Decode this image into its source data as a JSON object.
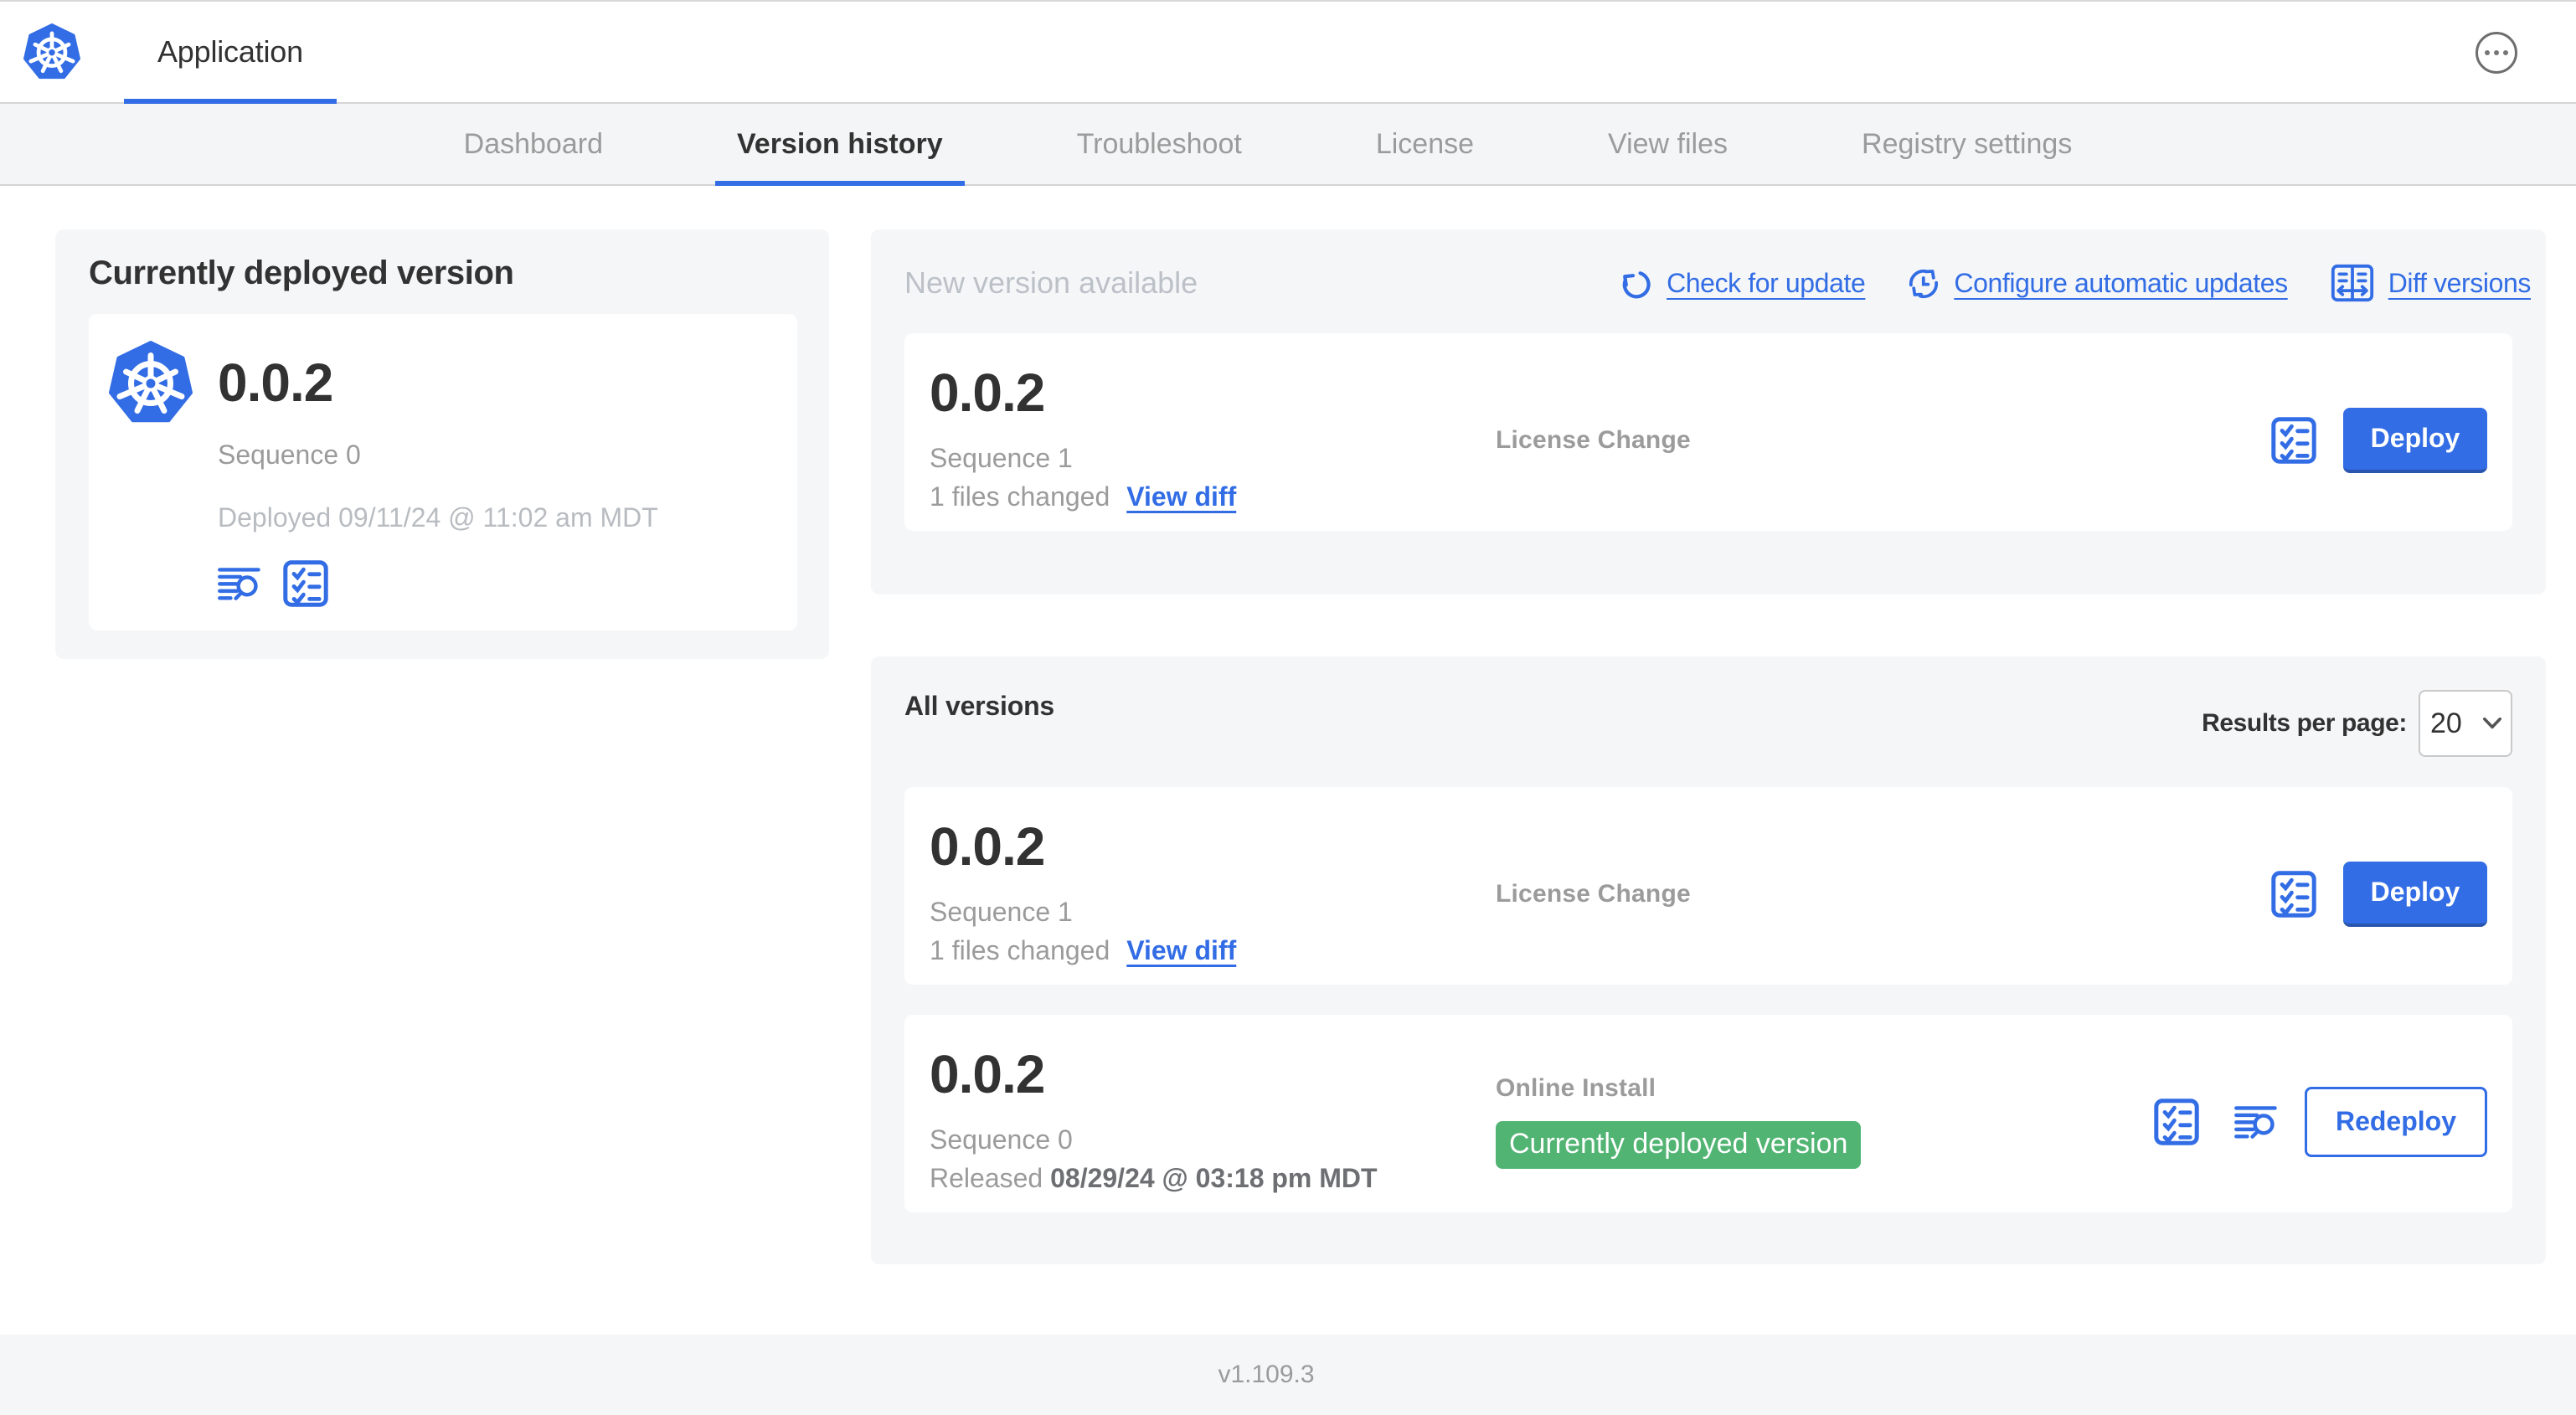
{
  "header": {
    "app_tab": "Application"
  },
  "nav": {
    "tabs": [
      {
        "label": "Dashboard"
      },
      {
        "label": "Version history"
      },
      {
        "label": "Troubleshoot"
      },
      {
        "label": "License"
      },
      {
        "label": "View files"
      },
      {
        "label": "Registry settings"
      }
    ],
    "active_tab": "Version history"
  },
  "deployed_panel": {
    "title": "Currently deployed version",
    "version": "0.0.2",
    "sequence": "Sequence 0",
    "deployed": "Deployed 09/11/24 @ 11:02 am MDT"
  },
  "new_version_panel": {
    "title": "New version available",
    "links": {
      "check": "Check for update",
      "configure": "Configure automatic updates",
      "diff": "Diff versions"
    },
    "card": {
      "version": "0.0.2",
      "sequence": "Sequence 1",
      "files_changed": "1 files changed",
      "view_diff": "View diff",
      "label": "License Change",
      "deploy": "Deploy"
    }
  },
  "all_versions_panel": {
    "title": "All versions",
    "results_per_page_label": "Results per page:",
    "results_per_page_value": "20",
    "rows": [
      {
        "version": "0.0.2",
        "sequence": "Sequence 1",
        "files_changed": "1 files changed",
        "view_diff": "View diff",
        "label": "License Change",
        "action": "Deploy"
      },
      {
        "version": "0.0.2",
        "sequence": "Sequence 0",
        "released_prefix": "Released",
        "released_date": "08/29/24 @ 03:18 pm MDT",
        "label": "Online Install",
        "badge": "Currently deployed version",
        "action": "Redeploy"
      }
    ]
  },
  "footer": {
    "version": "v1.109.3"
  },
  "colors": {
    "accent": "#326de5",
    "success_badge": "#52b473",
    "panel_bg": "#f5f6f8",
    "muted_text": "#9b9b9b",
    "dark_text": "#323232"
  }
}
